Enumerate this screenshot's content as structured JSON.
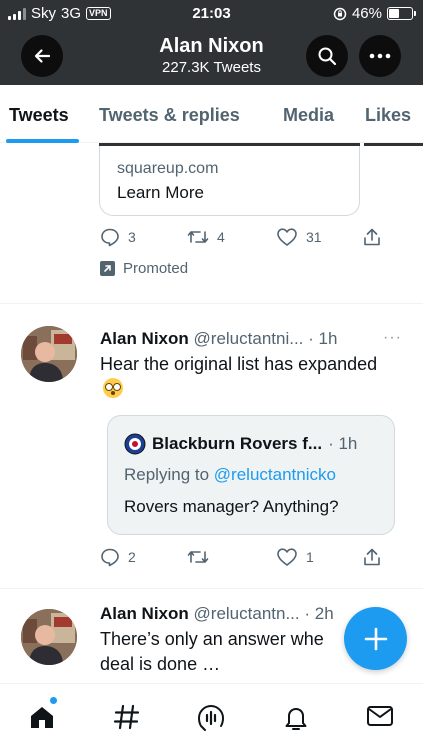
{
  "status_bar": {
    "carrier": "Sky",
    "network": "3G",
    "vpn": "VPN",
    "time": "21:03",
    "battery": "46%",
    "battery_level": 0.46
  },
  "header": {
    "title": "Alan Nixon",
    "subtitle": "227.3K Tweets",
    "icons": [
      "back-arrow-icon",
      "search-icon",
      "more-icon"
    ]
  },
  "tabs": [
    {
      "label": "Tweets",
      "active": true
    },
    {
      "label": "Tweets & replies",
      "active": false
    },
    {
      "label": "Media",
      "active": false
    },
    {
      "label": "Likes",
      "active": false
    }
  ],
  "promo_tweet": {
    "card_domain": "squareup.com",
    "card_cta": "Learn More",
    "replies": "3",
    "retweets": "4",
    "likes": "31",
    "promoted_label": "Promoted"
  },
  "tweets": [
    {
      "name": "Alan Nixon",
      "handle": "@reluctantni...",
      "time": "· 1h",
      "text": "Hear the original list has expanded",
      "emoji": "flushed-face-emoji",
      "quote": {
        "name": "Blackburn Rovers f...",
        "time": "· 1h",
        "replying_label": "Replying to",
        "mention": "@reluctantnicko",
        "text": "Rovers manager? Anything?"
      },
      "replies": "2",
      "retweets": "",
      "likes": "1"
    },
    {
      "name": "Alan Nixon",
      "handle": "@reluctantn...",
      "time": "· 2h",
      "text_line1": "There’s only an answer whe",
      "text_line2": "deal is done …"
    }
  ],
  "fab": {
    "icon": "plus-icon"
  },
  "bottom_nav": [
    "home-icon",
    "explore-hashtag-icon",
    "spaces-icon",
    "notifications-bell-icon",
    "messages-envelope-icon"
  ],
  "colors": {
    "accent": "#1d9bf0",
    "header_bg": "#2f3336",
    "secondary_text": "#536471"
  }
}
